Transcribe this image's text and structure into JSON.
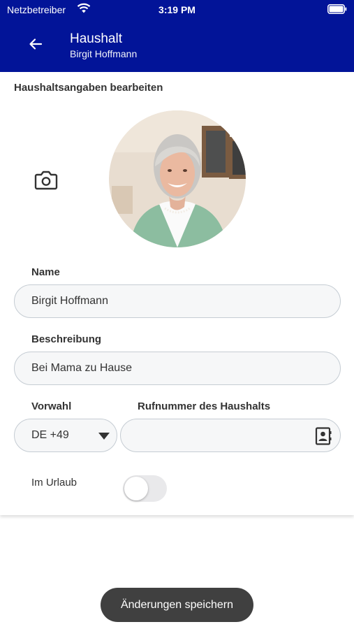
{
  "status_bar": {
    "carrier": "Netzbetreiber",
    "time": "3:19 PM"
  },
  "header": {
    "title": "Haushalt",
    "subtitle": "Birgit Hoffmann"
  },
  "form": {
    "section_title": "Haushaltsangaben bearbeiten",
    "name_label": "Name",
    "name_value": "Birgit Hoffmann",
    "description_label": "Beschreibung",
    "description_value": "Bei Mama zu Hause",
    "prefix_label": "Vorwahl",
    "prefix_value": "DE +49",
    "phone_label": "Rufnummer des Haushalts",
    "phone_value": "",
    "vacation_label": "Im Urlaub",
    "vacation_on": false
  },
  "save_button": "Änderungen speichern",
  "colors": {
    "header": "#021498",
    "save_button": "#404040",
    "field_border": "#c5ccd3"
  },
  "icons": [
    "wifi-icon",
    "battery-icon",
    "back-arrow-icon",
    "camera-icon",
    "caret-down-icon",
    "contact-book-icon"
  ]
}
